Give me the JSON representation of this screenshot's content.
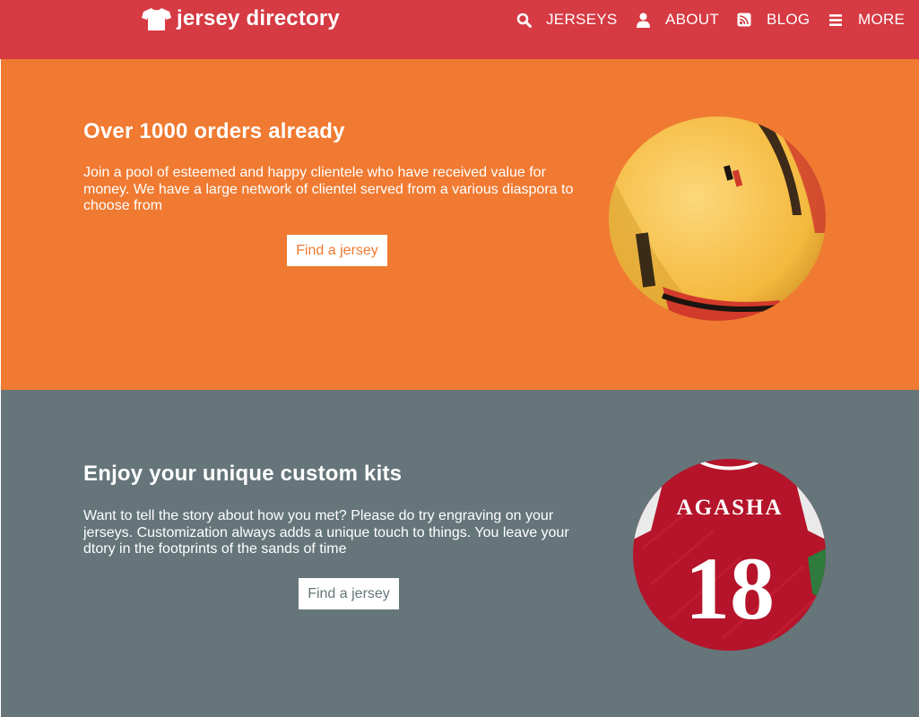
{
  "header": {
    "brand_name": "jersey directory",
    "brand_icon": "tshirt-icon",
    "background": "#d63a43",
    "nav": [
      {
        "label": "JERSEYS",
        "icon": "search-icon"
      },
      {
        "label": "ABOUT",
        "icon": "user-icon"
      },
      {
        "label": "BLOG",
        "icon": "rss-icon"
      },
      {
        "label": "MORE",
        "icon": "menu-icon"
      }
    ]
  },
  "sections": [
    {
      "title": "Over 1000 orders already",
      "body": "Join a pool of esteemed and happy clientele who have received value for money. We have a large network of clientel served from a various diaspora to choose from",
      "cta": "Find a jersey",
      "background": "#f07a31",
      "cta_color": "#f07a31"
    },
    {
      "title": "Enjoy your unique custom kits",
      "body": "Want to tell the story about how you met? Please do try engraving on your jerseys. Customization always adds a unique touch to things. You leave your dtory in the footprints of the sands of time",
      "cta": "Find a jersey",
      "background": "#65757a",
      "cta_color": "#65757a",
      "photo_text": {
        "name": "AGASHA",
        "number": "18"
      }
    }
  ]
}
